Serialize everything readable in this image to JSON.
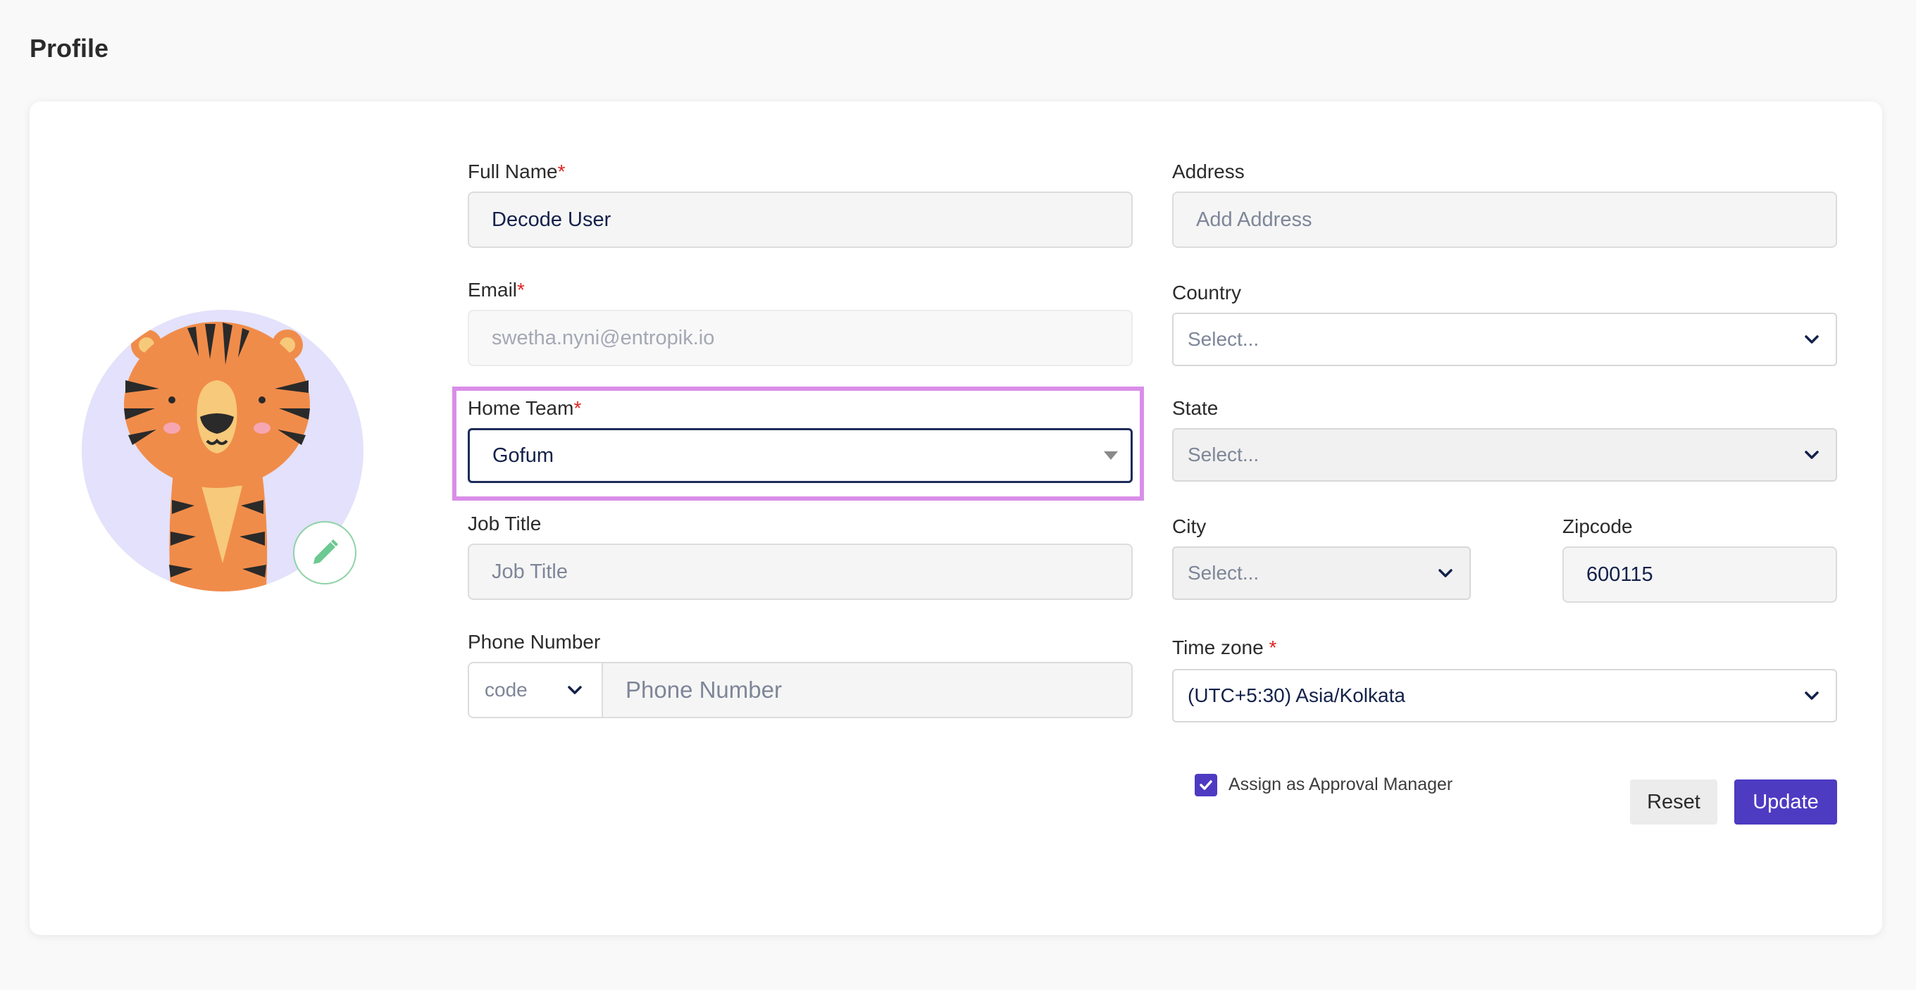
{
  "page": {
    "title": "Profile"
  },
  "form": {
    "full_name": {
      "label": "Full Name",
      "required_mark": "*",
      "value": "Decode User"
    },
    "email": {
      "label": "Email",
      "required_mark": "*",
      "value": "swetha.nyni@entropik.io"
    },
    "home_team": {
      "label": "Home Team",
      "required_mark": "*",
      "value": "Gofum"
    },
    "job_title": {
      "label": "Job Title",
      "placeholder": "Job Title"
    },
    "phone": {
      "label": "Phone Number",
      "code_placeholder": "code",
      "placeholder": "Phone Number"
    },
    "address": {
      "label": "Address",
      "placeholder": "Add Address"
    },
    "country": {
      "label": "Country",
      "placeholder": "Select..."
    },
    "state": {
      "label": "State",
      "placeholder": "Select..."
    },
    "city": {
      "label": "City",
      "placeholder": "Select..."
    },
    "zipcode": {
      "label": "Zipcode",
      "value": "600115"
    },
    "timezone": {
      "label": "Time zone ",
      "required_mark": "*",
      "value": "(UTC+5:30) Asia/Kolkata"
    },
    "approval_manager": {
      "label": "Assign as Approval Manager",
      "checked": true
    }
  },
  "buttons": {
    "reset": "Reset",
    "update": "Update"
  },
  "avatar": {
    "icon": "tiger-avatar",
    "edit_icon": "pencil-icon"
  },
  "colors": {
    "accent": "#4d3bc2",
    "highlight": "#d98ee8",
    "required": "#e02424",
    "edit": "#6cc991"
  }
}
